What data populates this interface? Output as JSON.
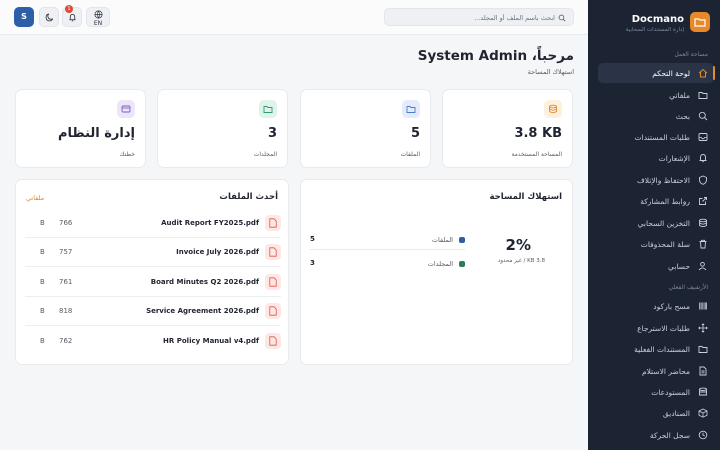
{
  "brand": {
    "name": "Docmano",
    "subtitle": "إدارة المستندات السحابية"
  },
  "sidebar": {
    "section_workspace": "مساحة العمل",
    "section_archive": "الأرشيف الفعلي",
    "items": [
      {
        "label": "لوحة التحكم",
        "icon": "home-icon",
        "active": true
      },
      {
        "label": "ملفاتي",
        "icon": "folder-icon"
      },
      {
        "label": "بحث",
        "icon": "search-icon"
      },
      {
        "label": "طلبات المستندات",
        "icon": "inbox-icon"
      },
      {
        "label": "الإشعارات",
        "icon": "bell-icon"
      },
      {
        "label": "الاحتفاظ والإتلاف",
        "icon": "shield-icon"
      },
      {
        "label": "روابط المشاركة",
        "icon": "external-link-icon"
      },
      {
        "label": "التخزين السحابي",
        "icon": "database-icon"
      },
      {
        "label": "سلة المحذوفات",
        "icon": "trash-icon"
      },
      {
        "label": "حسابي",
        "icon": "user-icon"
      }
    ],
    "archive_items": [
      {
        "label": "مسح باركود",
        "icon": "barcode-icon"
      },
      {
        "label": "طلبات الاسترجاع",
        "icon": "move-icon"
      },
      {
        "label": "المستندات الفعلية",
        "icon": "folder-icon"
      },
      {
        "label": "محاضر الاستلام",
        "icon": "file-text-icon"
      },
      {
        "label": "المستودعات",
        "icon": "archive-icon"
      },
      {
        "label": "الصناديق",
        "icon": "box-icon"
      },
      {
        "label": "سجل الحركة",
        "icon": "clock-icon"
      }
    ]
  },
  "header": {
    "avatar_initial": "S",
    "notification_count": "1",
    "language": "EN",
    "search_placeholder": "ابحث باسم الملف أو المجلد..."
  },
  "welcome": {
    "title": "مرحباً، System Admin",
    "subtitle": "استهلاك المساحة"
  },
  "stats": [
    {
      "value": "3.8 KB",
      "label": "المساحة المستخدمة",
      "icon": "database-icon",
      "color": "#e6892a",
      "bg": "#fdf0dd"
    },
    {
      "value": "5",
      "label": "الملفات",
      "icon": "folder-icon",
      "color": "#4a7bd0",
      "bg": "#e4ecfb"
    },
    {
      "value": "3",
      "label": "المجلدات",
      "icon": "folder-icon",
      "color": "#2f9e6e",
      "bg": "#dff3ea"
    },
    {
      "value": "إدارة النظام",
      "label": "خطتك",
      "icon": "card-icon",
      "color": "#7b5fc7",
      "bg": "#ece6f8"
    }
  ],
  "storage": {
    "title": "استهلاك المساحة",
    "percent": "2%",
    "note": "3.8 KB / غير محدود",
    "legend": [
      {
        "label": "الملفات",
        "count": "5",
        "color": "#2d5fa6"
      },
      {
        "label": "المجلدات",
        "count": "3",
        "color": "#2f7a5a"
      }
    ]
  },
  "recent": {
    "title": "أحدث الملفات",
    "link": "ملفاتي",
    "files": [
      {
        "name": "Audit Report FY2025.pdf",
        "size": "766",
        "unit": "B"
      },
      {
        "name": "Invoice July 2026.pdf",
        "size": "757",
        "unit": "B"
      },
      {
        "name": "Board Minutes Q2 2026.pdf",
        "size": "761",
        "unit": "B"
      },
      {
        "name": "Service Agreement 2026.pdf",
        "size": "818",
        "unit": "B"
      },
      {
        "name": "HR Policy Manual v4.pdf",
        "size": "762",
        "unit": "B"
      }
    ]
  }
}
